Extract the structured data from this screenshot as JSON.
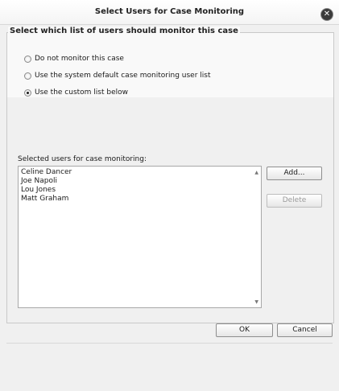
{
  "dialog": {
    "title": "Select Users for Case Monitoring",
    "close_symbol": "✕"
  },
  "group": {
    "legend": "Select which list of users should monitor this case"
  },
  "options": [
    {
      "label": "Do not monitor this case",
      "checked": false
    },
    {
      "label": "Use the system default case monitoring user list",
      "checked": false
    },
    {
      "label": "Use the custom list below",
      "checked": true
    }
  ],
  "user_list": {
    "label": "Selected users for case monitoring:",
    "users": [
      "Celine Dancer",
      "Joe Napoli",
      "Lou Jones",
      "Matt Graham"
    ]
  },
  "buttons": {
    "add": "Add...",
    "delete": "Delete",
    "ok": "OK",
    "cancel": "Cancel"
  },
  "icons": {
    "close": "close-icon",
    "scroll_up": "scroll-up-arrow-icon",
    "scroll_down": "scroll-down-arrow-icon"
  }
}
